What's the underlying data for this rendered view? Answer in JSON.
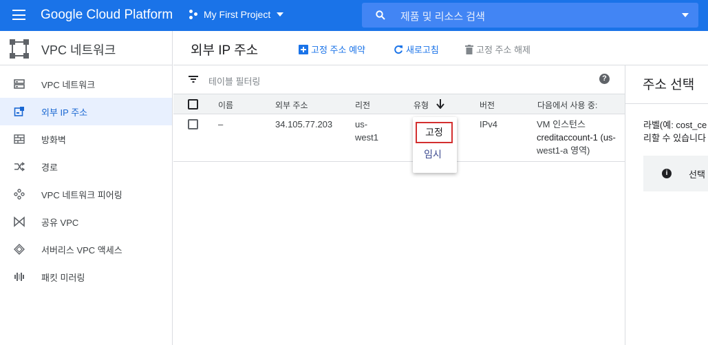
{
  "topbar": {
    "brand": "Google Cloud Platform",
    "project": "My First Project",
    "search_placeholder": "제품 및 리소스 검색"
  },
  "sidebar": {
    "title": "VPC 네트워크",
    "items": [
      {
        "label": "VPC 네트워크",
        "icon": "vpc-network-icon"
      },
      {
        "label": "외부 IP 주소",
        "icon": "external-ip-icon",
        "active": true
      },
      {
        "label": "방화벽",
        "icon": "firewall-icon"
      },
      {
        "label": "경로",
        "icon": "routes-icon"
      },
      {
        "label": "VPC 네트워크 피어링",
        "icon": "peering-icon"
      },
      {
        "label": "공유 VPC",
        "icon": "shared-vpc-icon"
      },
      {
        "label": "서버리스 VPC 액세스",
        "icon": "serverless-icon"
      },
      {
        "label": "패킷 미러링",
        "icon": "packet-mirroring-icon"
      }
    ]
  },
  "main": {
    "title": "외부 IP 주소",
    "actions": {
      "reserve": "고정 주소 예약",
      "refresh": "새로고침",
      "release": "고정 주소 해제"
    },
    "filter_placeholder": "테이블 필터링",
    "columns": {
      "name": "이름",
      "address": "외부 주소",
      "region": "리전",
      "type": "유형",
      "version": "버전",
      "used_by": "다음에서 사용 중:"
    },
    "rows": [
      {
        "name": "–",
        "address": "34.105.77.203",
        "region_line1": "us-",
        "region_line2": "west1",
        "version": "IPv4",
        "used_by_line1": "VM 인스턴스",
        "used_by_line2": "creditaccount-1 (us-",
        "used_by_line3": "west1-a 영역)"
      }
    ],
    "type_menu": {
      "options": [
        "고정",
        "임시"
      ],
      "highlighted": "고정"
    }
  },
  "right_panel": {
    "title": "주소 선택",
    "text_line1": "라벨(예: cost_ce",
    "text_line2": "리할 수 있습니다",
    "info_text": "선택"
  },
  "colors": {
    "topbar": "#1a73e8",
    "search": "#4285f4",
    "active_nav_bg": "#e8f0fe",
    "accent": "#1a73e8",
    "highlight_border": "#d32f2f"
  }
}
